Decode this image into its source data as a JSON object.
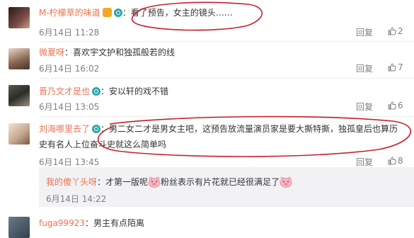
{
  "comments": [
    {
      "name": "M-柠檬草的味道",
      "text": "：看了预告，女主的镜头……",
      "time": "6月14日 11:28",
      "reply": "回复",
      "likes": "2",
      "avatar_color": "#4a2a2a"
    },
    {
      "name": "微夏呀",
      "text": "：喜欢宇文护和独孤般若的线",
      "time": "6月14日 16:02",
      "reply": "回复",
      "likes": "7",
      "avatar_color": "#6b4c3b"
    },
    {
      "name": "晋乃文才是也",
      "text": "：安以轩的戏不错",
      "time": "6月14日 13:05",
      "reply": "回复",
      "likes": "6",
      "avatar_color": "#3b3a36"
    },
    {
      "name": "刘海哪里去了",
      "text": "：男二女二才是男女主吧，这预告放流量演员家是要大撕特撕，独孤皇后也算历",
      "text_line2": "史有名人上位奋斗史就这么简单吗",
      "time": "6月14日 13:45",
      "reply": "回复",
      "likes": "8",
      "avatar_color": "#d9c8b5"
    }
  ],
  "sub_reply": {
    "name": "我的傻丫头呀",
    "text_part1": "：才第一版呢",
    "text_part2": "粉丝表示有片花就已经很满足了",
    "time": "6月14日 14:22"
  },
  "partial_comment": {
    "name": "fuga99923",
    "text": "：男主有点陌离"
  },
  "colors": {
    "name_orange": "#eb7350",
    "name_blue": "#5d7fb3",
    "annotation_red": "#c8202a"
  }
}
